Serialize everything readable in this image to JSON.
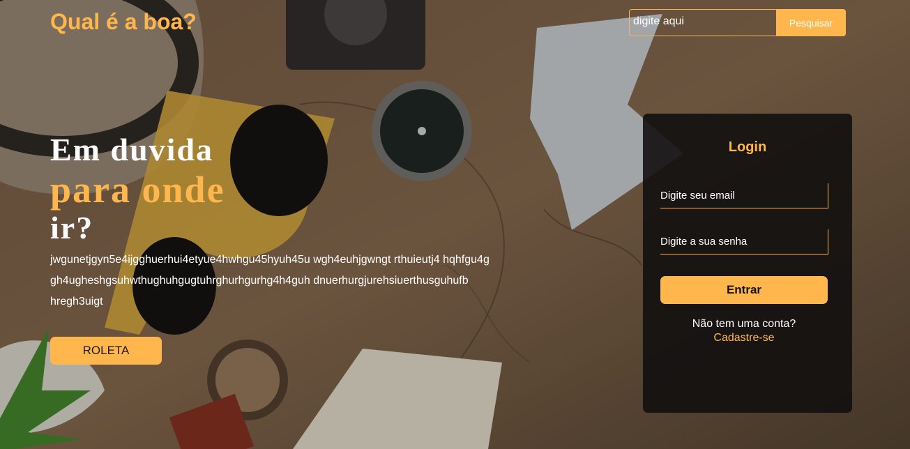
{
  "header": {
    "logo": "Qual é a boa?",
    "search_placeholder": "digite aqui",
    "search_button": "Pesquisar"
  },
  "hero": {
    "line1": "Em duvida",
    "line2": "para onde",
    "line3": "ir?",
    "text": "jwgunetjgyn5e4ijgghuerhui4etyue4hwhgu45hyuh45u wgh4euhjgwngt rthuieutj4 hqhfgu4g gh4ugheshgsuhwthughuhgugtuhrghurhgurhg4h4guh dnuerhurgjurehsiuerthusguhufb hregh3uigt",
    "roleta_button": "ROLETA"
  },
  "login": {
    "title": "Login",
    "email_placeholder": "Digite seu email",
    "password_placeholder": "Digite a sua senha",
    "submit_button": "Entrar",
    "signup_text": "Não tem uma conta?",
    "signup_link": "Cadastre-se"
  },
  "colors": {
    "accent": "#ffb74d",
    "card_bg": "#12100f",
    "text": "#ffffff"
  }
}
